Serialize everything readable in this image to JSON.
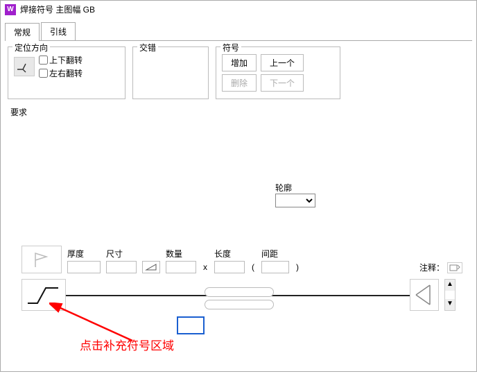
{
  "title": "焊接符号 主图幅 GB",
  "tabs": {
    "general": "常规",
    "leader": "引线"
  },
  "groups": {
    "orient": {
      "title": "定位方向",
      "flip_v": "上下翻转",
      "flip_h": "左右翻转"
    },
    "stagger": {
      "title": "交错"
    },
    "symbol": {
      "title": "符号",
      "add": "增加",
      "prev": "上一个",
      "delete": "删除",
      "next": "下一个"
    }
  },
  "requirements_label": "要求",
  "contour_label": "轮廓",
  "fields": {
    "thickness": "厚度",
    "size": "尺寸",
    "qty": "数量",
    "length": "长度",
    "pitch": "间距",
    "note": "注释："
  },
  "sep_x": "x",
  "paren_l": "(",
  "paren_r": ")",
  "annotation": "点击补充符号区域"
}
